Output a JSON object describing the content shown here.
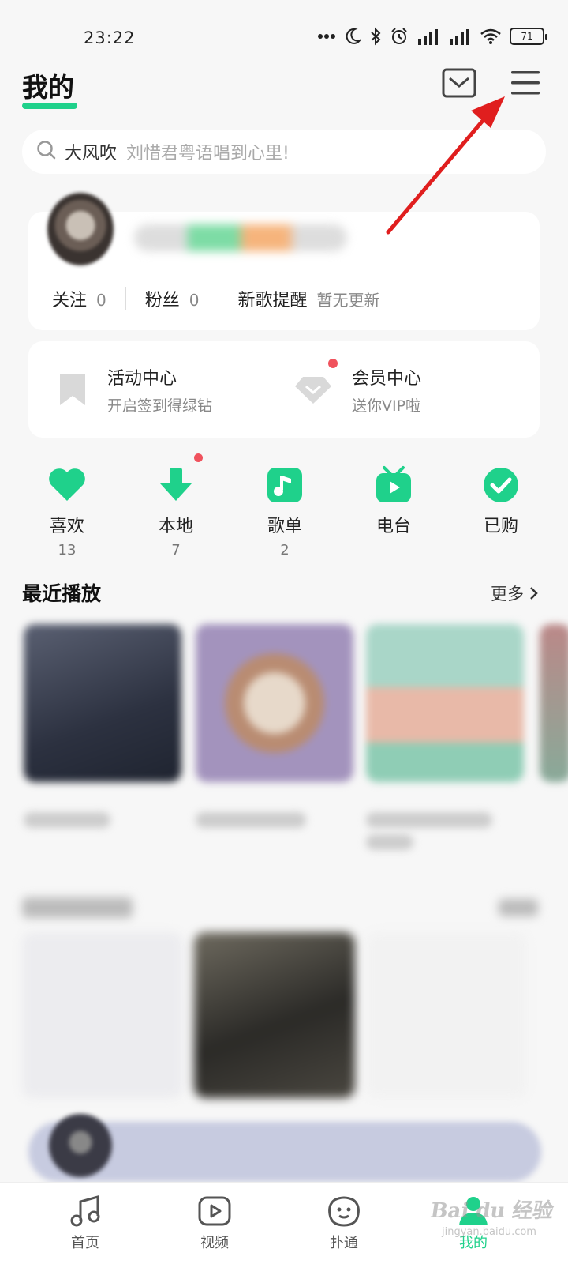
{
  "status_bar": {
    "time": "23:22",
    "battery": "71"
  },
  "header": {
    "title": "我的"
  },
  "search": {
    "hot_word": "大风吹",
    "hint": "刘惜君粤语唱到心里!"
  },
  "profile": {
    "follow_label": "关注",
    "follow_count": "0",
    "fans_label": "粉丝",
    "fans_count": "0",
    "new_song_label": "新歌提醒",
    "new_song_status": "暂无更新"
  },
  "activities": [
    {
      "title": "活动中心",
      "subtitle": "开启签到得绿钻",
      "icon": "bookmark-icon"
    },
    {
      "title": "会员中心",
      "subtitle": "送你VIP啦",
      "icon": "diamond-icon"
    }
  ],
  "quick_items": [
    {
      "label": "喜欢",
      "count": "13",
      "icon": "heart-icon"
    },
    {
      "label": "本地",
      "count": "7",
      "icon": "download-icon"
    },
    {
      "label": "歌单",
      "count": "2",
      "icon": "music-note-icon"
    },
    {
      "label": "电台",
      "count": "",
      "icon": "radio-tv-icon"
    },
    {
      "label": "已购",
      "count": "",
      "icon": "check-circle-icon"
    }
  ],
  "recent": {
    "title": "最近播放",
    "more": "更多"
  },
  "bottom_nav": [
    {
      "label": "首页",
      "icon": "music-icon"
    },
    {
      "label": "视频",
      "icon": "video-play-icon"
    },
    {
      "label": "扑通",
      "icon": "face-icon"
    },
    {
      "label": "我的",
      "icon": "profile-icon",
      "active": true
    }
  ],
  "colors": {
    "accent": "#1fd18b",
    "alert": "#f0525d",
    "annotation_arrow": "#e01e1e"
  },
  "watermark": {
    "brand": "Bai du 经验",
    "url": "jingyan.baidu.com"
  }
}
